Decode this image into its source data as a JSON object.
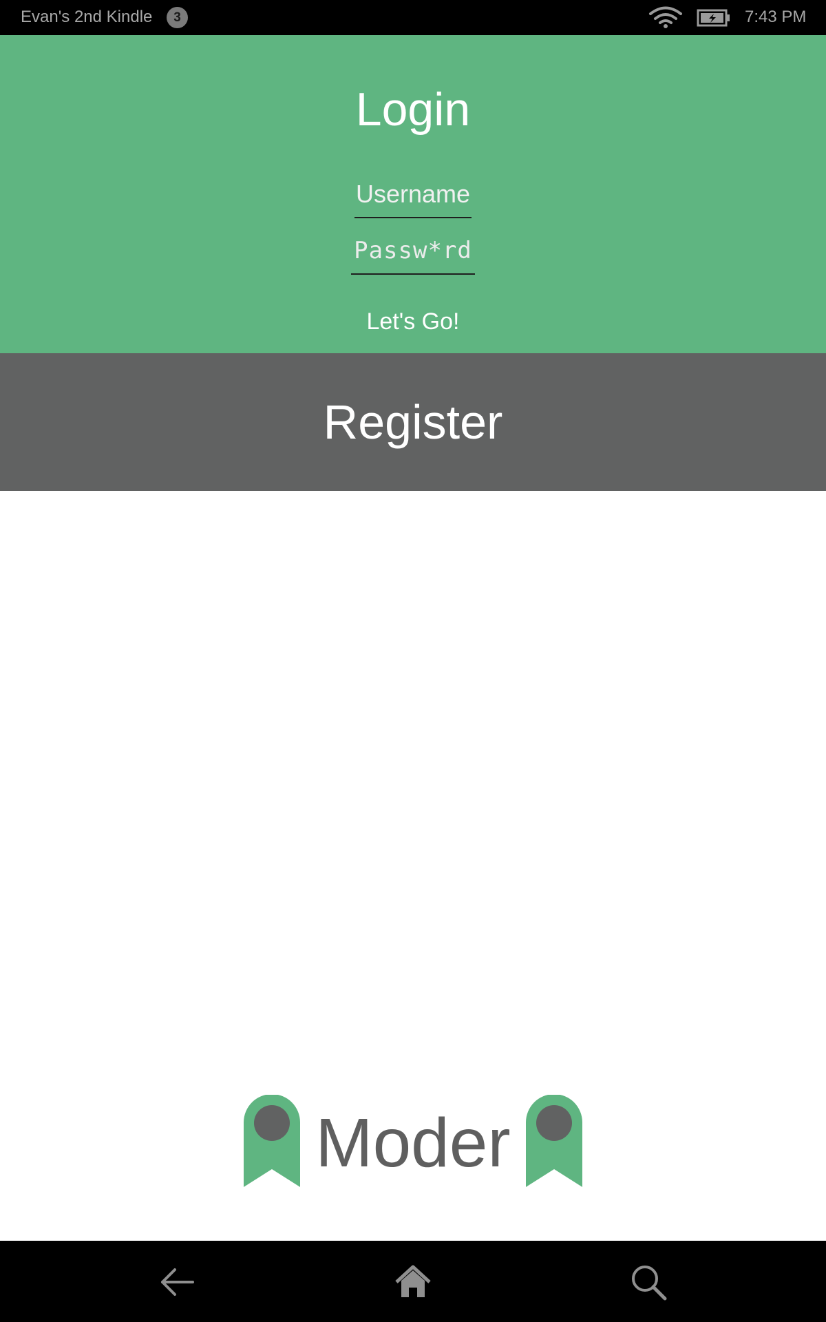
{
  "status_bar": {
    "device_name": "Evan's 2nd Kindle",
    "notification_count": "3",
    "time": "7:43 PM",
    "icons": [
      "wifi-icon",
      "battery-charging-icon"
    ]
  },
  "login": {
    "title": "Login",
    "username_placeholder": "Username",
    "password_placeholder": "Passw*rd",
    "submit_label": "Let's Go!"
  },
  "register": {
    "label": "Register"
  },
  "logo": {
    "text": "Moder",
    "icon": "ribbon-badge-icon"
  },
  "nav_bar": {
    "icons": [
      "back-arrow-icon",
      "home-icon",
      "search-icon"
    ]
  },
  "colors": {
    "login_background": "#5fb581",
    "register_background": "#616262",
    "logo_text": "#5f5f5f",
    "ribbon_green": "#5fb581",
    "ribbon_dot": "#616262",
    "system_bars": "#000000"
  }
}
